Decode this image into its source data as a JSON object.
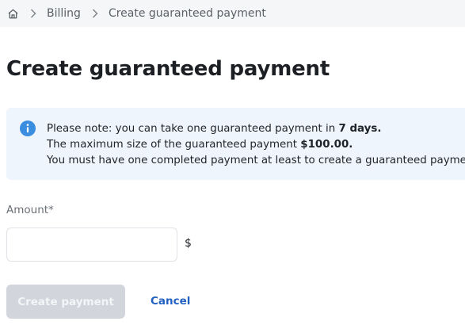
{
  "breadcrumb": {
    "home_icon": "home-icon",
    "separator_icon": "chevron-right-icon",
    "items": [
      {
        "label": "Billing"
      },
      {
        "label": "Create guaranteed payment"
      }
    ]
  },
  "page": {
    "title": "Create guaranteed payment"
  },
  "notice": {
    "icon": "info-icon",
    "line1_prefix": "Please note: you can take one guaranteed payment in ",
    "line1_bold": "7 days.",
    "line2_prefix": "The maximum size of the guaranteed payment ",
    "line2_bold": "$100.00.",
    "line3": "You must have one completed payment at least to create a guaranteed payment."
  },
  "form": {
    "amount_label": "Amount*",
    "amount_value": "",
    "currency_symbol": "$",
    "submit_label": "Create payment",
    "cancel_label": "Cancel"
  },
  "colors": {
    "info_blue": "#3b8de0",
    "link_blue": "#2361c1",
    "notice_bg": "#eef5fd",
    "disabled_button": "#d2d6dc"
  }
}
